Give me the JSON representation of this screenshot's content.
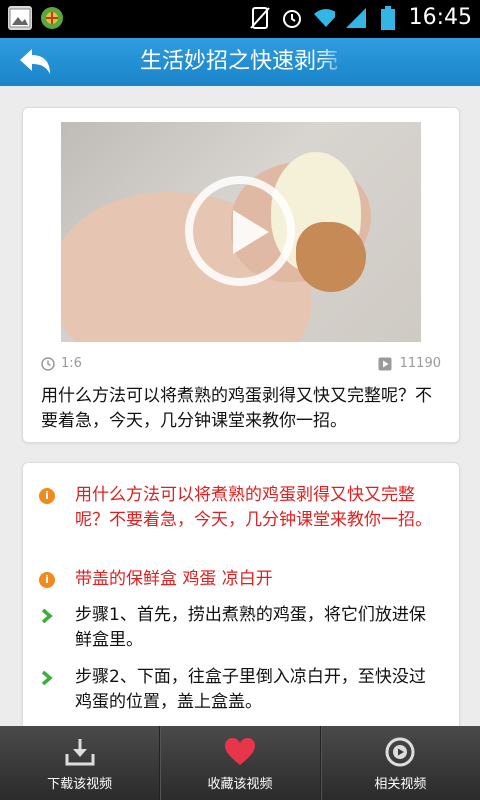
{
  "status_bar": {
    "time": "16:45",
    "icons": [
      "image-notification-icon",
      "app-notification-icon",
      "no-sim-icon",
      "alarm-icon",
      "wifi-icon",
      "signal-icon",
      "battery-icon"
    ]
  },
  "header": {
    "title": "生活妙招之快速剥壳",
    "back_icon": "back-arrow-icon",
    "bg_color": "#1e8fd6"
  },
  "video": {
    "duration": "1:6",
    "views": "11190",
    "description": "用什么方法可以将煮熟的鸡蛋剥得又快又完整呢？不要着急，今天，几分钟课堂来教你一招。"
  },
  "steps": [
    {
      "icon": "info-icon",
      "color": "#e02020",
      "text": "用什么方法可以将煮熟的鸡蛋剥得又快又完整呢？不要着急，今天，几分钟课堂来教你一招。"
    },
    {
      "icon": "info-icon",
      "color": "#e02020",
      "text": "带盖的保鲜盒 鸡蛋 凉白开"
    },
    {
      "icon": "chevron-right-icon",
      "color": "#111111",
      "text": "步骤1、首先，捞出煮熟的鸡蛋，将它们放进保鲜盒里。"
    },
    {
      "icon": "chevron-right-icon",
      "color": "#111111",
      "text": "步骤2、下面，往盒子里倒入凉白开，至快没过鸡蛋的位置，盖上盒盖。"
    }
  ],
  "bottom_bar": [
    {
      "label": "下载该视频",
      "icon": "download-icon"
    },
    {
      "label": "收藏该视频",
      "icon": "heart-icon"
    },
    {
      "label": "相关视频",
      "icon": "related-video-icon"
    }
  ],
  "colors": {
    "accent": "#1e8fd6",
    "highlight_text": "#e02020",
    "heart": "#e8354a",
    "info_icon": "#f08a1d",
    "chevron": "#3cae3a"
  }
}
